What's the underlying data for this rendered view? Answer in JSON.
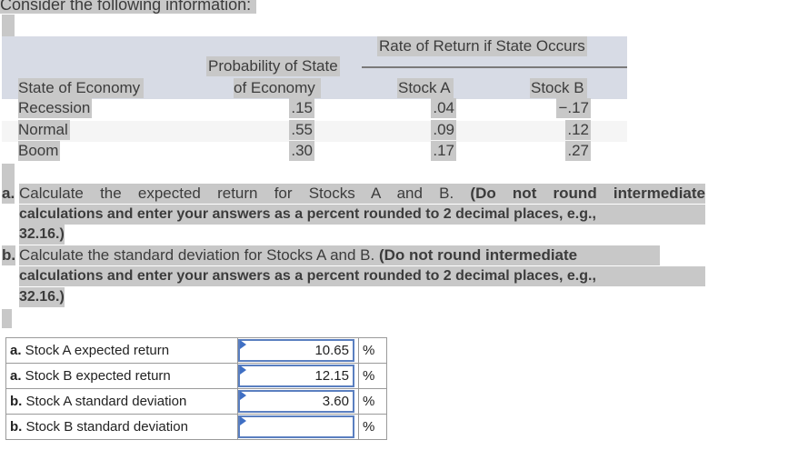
{
  "intro": "Consider the following information:",
  "table": {
    "group_header": "Rate of Return if State Occurs",
    "headers": {
      "state": "State of Economy",
      "probability_line1": "Probability of State",
      "probability_line2": "of Economy",
      "stock_a": "Stock A",
      "stock_b": "Stock B"
    },
    "rows": [
      {
        "state": "Recession",
        "probability": ".15",
        "stock_a": ".04",
        "stock_b": "−.17"
      },
      {
        "state": "Normal",
        "probability": ".55",
        "stock_a": ".09",
        "stock_b": ".12"
      },
      {
        "state": "Boom",
        "probability": ".30",
        "stock_a": ".17",
        "stock_b": ".27"
      }
    ]
  },
  "questions": [
    {
      "label": "a.",
      "line1_text": "Calculate the expected return for Stocks A and B. ",
      "line1_bold": "(Do not round intermediate",
      "line2_bold": "calculations and enter your answers as a percent rounded to 2 decimal places, e.g.,",
      "line3_bold": "32.16.)"
    },
    {
      "label": "b.",
      "line1_text": "Calculate the standard deviation for Stocks A and B. ",
      "line1_bold": "(Do not round intermediate",
      "line2_bold": "calculations and enter your answers as a percent rounded to 2 decimal places, e.g.,",
      "line3_bold": "32.16.)"
    }
  ],
  "answers": [
    {
      "prefix": "a.",
      "label": " Stock A expected return",
      "value": "10.65",
      "unit": "%"
    },
    {
      "prefix": "a.",
      "label": " Stock B expected return",
      "value": "12.15",
      "unit": "%"
    },
    {
      "prefix": "b.",
      "label": " Stock A standard deviation",
      "value": "3.60",
      "unit": "%"
    },
    {
      "prefix": "b.",
      "label": " Stock B standard deviation",
      "value": "",
      "unit": "%"
    }
  ]
}
